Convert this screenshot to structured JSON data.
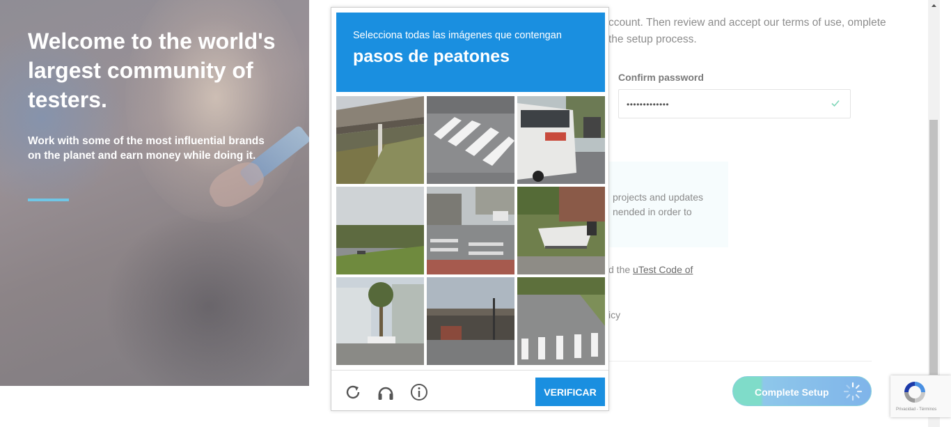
{
  "hero": {
    "title": "Welcome to the world's largest community of testers.",
    "subtitle": "Work with some of the most influential brands on the planet and earn money while doing it."
  },
  "form": {
    "intro_text": "ccount. Then review and accept our terms of use, omplete the setup process.",
    "confirm_password_label": "Confirm password",
    "confirm_password_value": "•••••••••••••",
    "info_text": "projects and updates nended in order to",
    "code_of_prefix": "d the ",
    "code_of_link": "uTest Code of",
    "policy_fragment": "icy",
    "complete_setup_label": "Complete Setup"
  },
  "captcha": {
    "instruction": "Selecciona todas las imágenes que contengan",
    "target": "pasos de peatones",
    "verify_label": "VERIFICAR",
    "tiles": [
      "Bridge underpass with grass embankment",
      "Crosswalk stripes on asphalt",
      "City bus on street with parked cars",
      "Highway with grassy median",
      "Intersection with crosswalk and buildings",
      "Boat on trailer near house",
      "Houses with palm tree",
      "Bridge over intersection",
      "Road with crosswalk stripes"
    ]
  },
  "recaptcha_badge": {
    "links": "Privacidad - Términos"
  },
  "colors": {
    "captcha_blue": "#1a8fe0",
    "accent_line": "#6fc6e6",
    "setup_button_start": "#7fdcc9",
    "setup_button_end": "#7fb4ea"
  }
}
